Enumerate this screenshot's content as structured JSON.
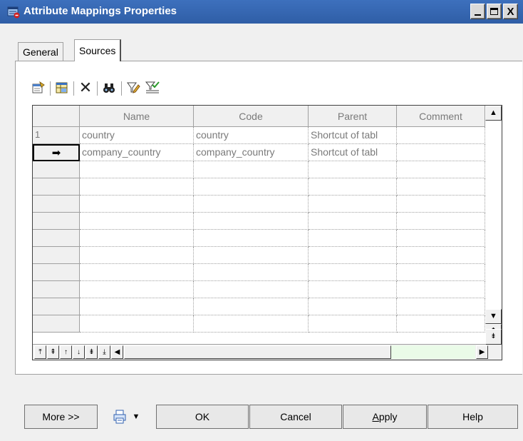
{
  "window": {
    "title": "Attribute Mappings Properties",
    "controls": {
      "minimize": "_",
      "maximize": "□",
      "close": "X"
    }
  },
  "tabs": [
    {
      "label": "General",
      "selected": false
    },
    {
      "label": "Sources",
      "selected": true
    }
  ],
  "toolbar": {
    "icons": [
      "properties-icon",
      "add-objects-icon",
      "delete-icon",
      "find-icon",
      "filter-icon",
      "customize-columns-icon"
    ],
    "delete_glyph": "✕",
    "find_glyph": "👁"
  },
  "grid": {
    "columns": [
      "Name",
      "Code",
      "Parent",
      "Comment"
    ],
    "rows": [
      {
        "row_header": "1",
        "name": "country",
        "code": "country",
        "parent": "Shortcut of tabl",
        "comment": ""
      },
      {
        "row_header": "➡",
        "name": "company_country",
        "code": "company_country",
        "parent": "Shortcut of tabl",
        "comment": ""
      }
    ],
    "empty_rows": 12
  },
  "navigation": {
    "buttons": [
      "⤒",
      "⇞",
      "↑",
      "↓",
      "⇟",
      "⤓",
      "◀"
    ],
    "scroll_right": "▶"
  },
  "scrollbar": {
    "up": "▲",
    "down": "▼",
    "page_up": "⇞",
    "page_down": "⇟"
  },
  "footer": {
    "more": "More >>",
    "print_arrow": "▼",
    "ok": "OK",
    "cancel": "Cancel",
    "apply_underlined": "A",
    "apply_rest": "pply",
    "help": "Help"
  }
}
